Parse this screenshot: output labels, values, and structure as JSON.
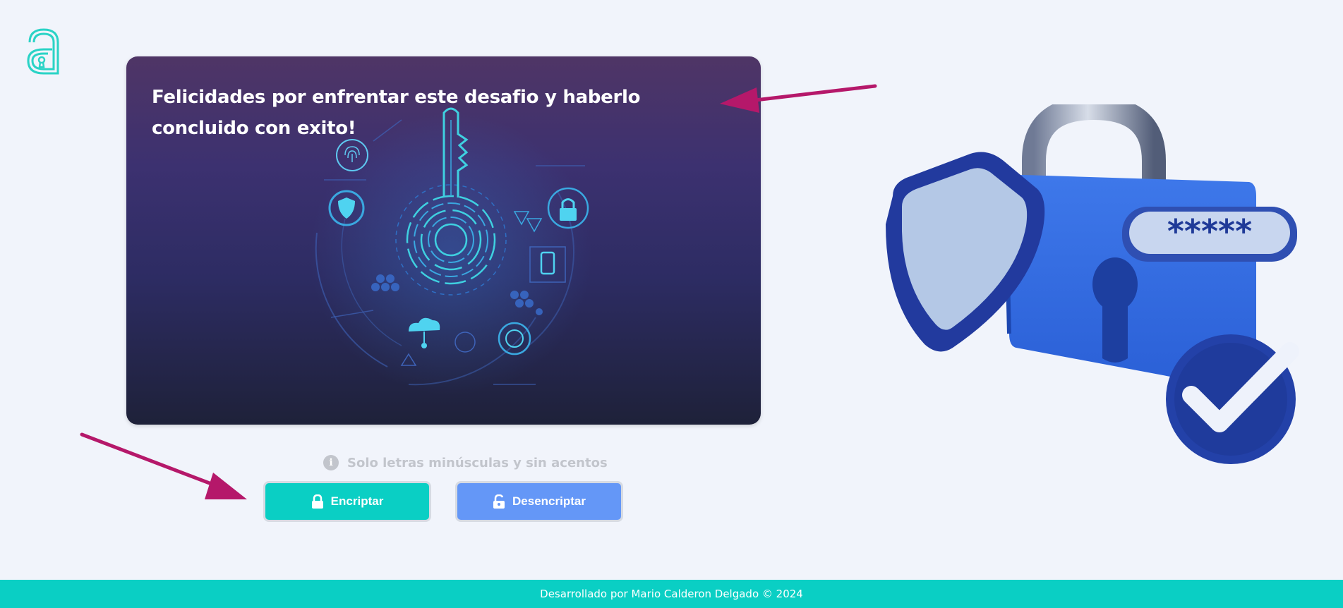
{
  "message": {
    "text": "Felicidades por enfrentar este desafio y haberlo concluido con exito!"
  },
  "hint": {
    "icon": "info-icon",
    "text": "Solo letras minúsculas y sin acentos"
  },
  "buttons": {
    "encrypt_label": "Encriptar",
    "decrypt_label": "Desencriptar"
  },
  "lock_illustration": {
    "password_mask": "*****"
  },
  "footer": {
    "text": "Desarrollado por Mario Calderon Delgado © 2024"
  },
  "colors": {
    "accent": "#0acfc4",
    "secondary": "#6497f7",
    "arrow": "#b5186a",
    "background": "#f1f4fb"
  }
}
